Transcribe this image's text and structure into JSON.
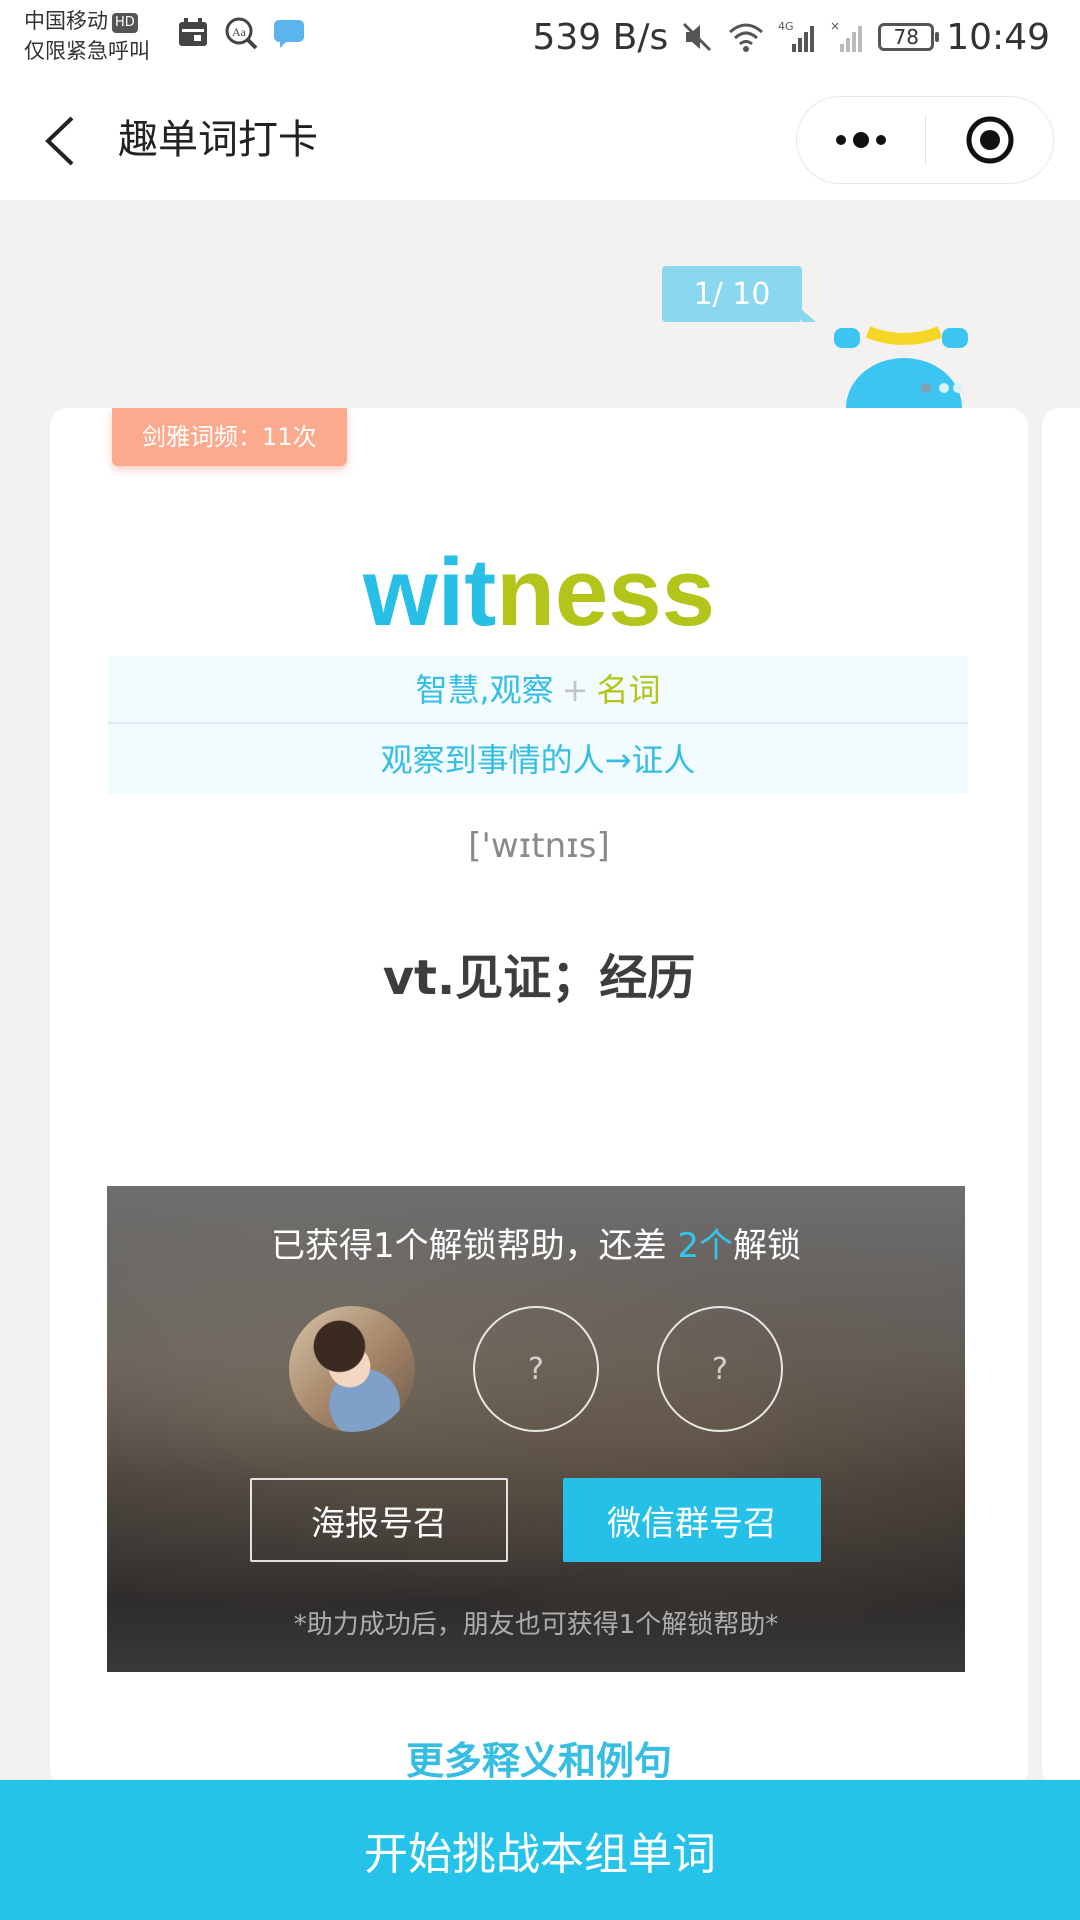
{
  "status_bar": {
    "carrier": "中国移动",
    "hd": "HD",
    "emergency": "仅限紧急呼叫",
    "net_speed": "539 B/s",
    "battery": "78",
    "time": "10:49"
  },
  "nav": {
    "title": "趣单词打卡"
  },
  "progress": "1/ 10",
  "card": {
    "frequency_tag": "剑雅词频：11次",
    "word_root": "wit",
    "word_suffix": "ness",
    "etymology": {
      "root_meaning": "智慧,观察",
      "plus": "+",
      "suffix_meaning": "名词",
      "explanation": "观察到事情的人→证人"
    },
    "phonetic": "['wɪtnɪs]",
    "definition": "vt.见证；经历",
    "unlock": {
      "text_before": "已获得1个解锁帮助，还差 ",
      "remaining": "2个",
      "text_after": "解锁",
      "slot_placeholder": "?",
      "poster_button": "海报号召",
      "wechat_button": "微信群号召",
      "note": "*助力成功后，朋友也可获得1个解锁帮助*"
    },
    "more_link": "更多释义和例句"
  },
  "cta": "开始挑战本组单词",
  "colors": {
    "accent": "#25c2ea",
    "suffix": "#b3c51b",
    "frequency_tag": "#fcaa8e"
  }
}
